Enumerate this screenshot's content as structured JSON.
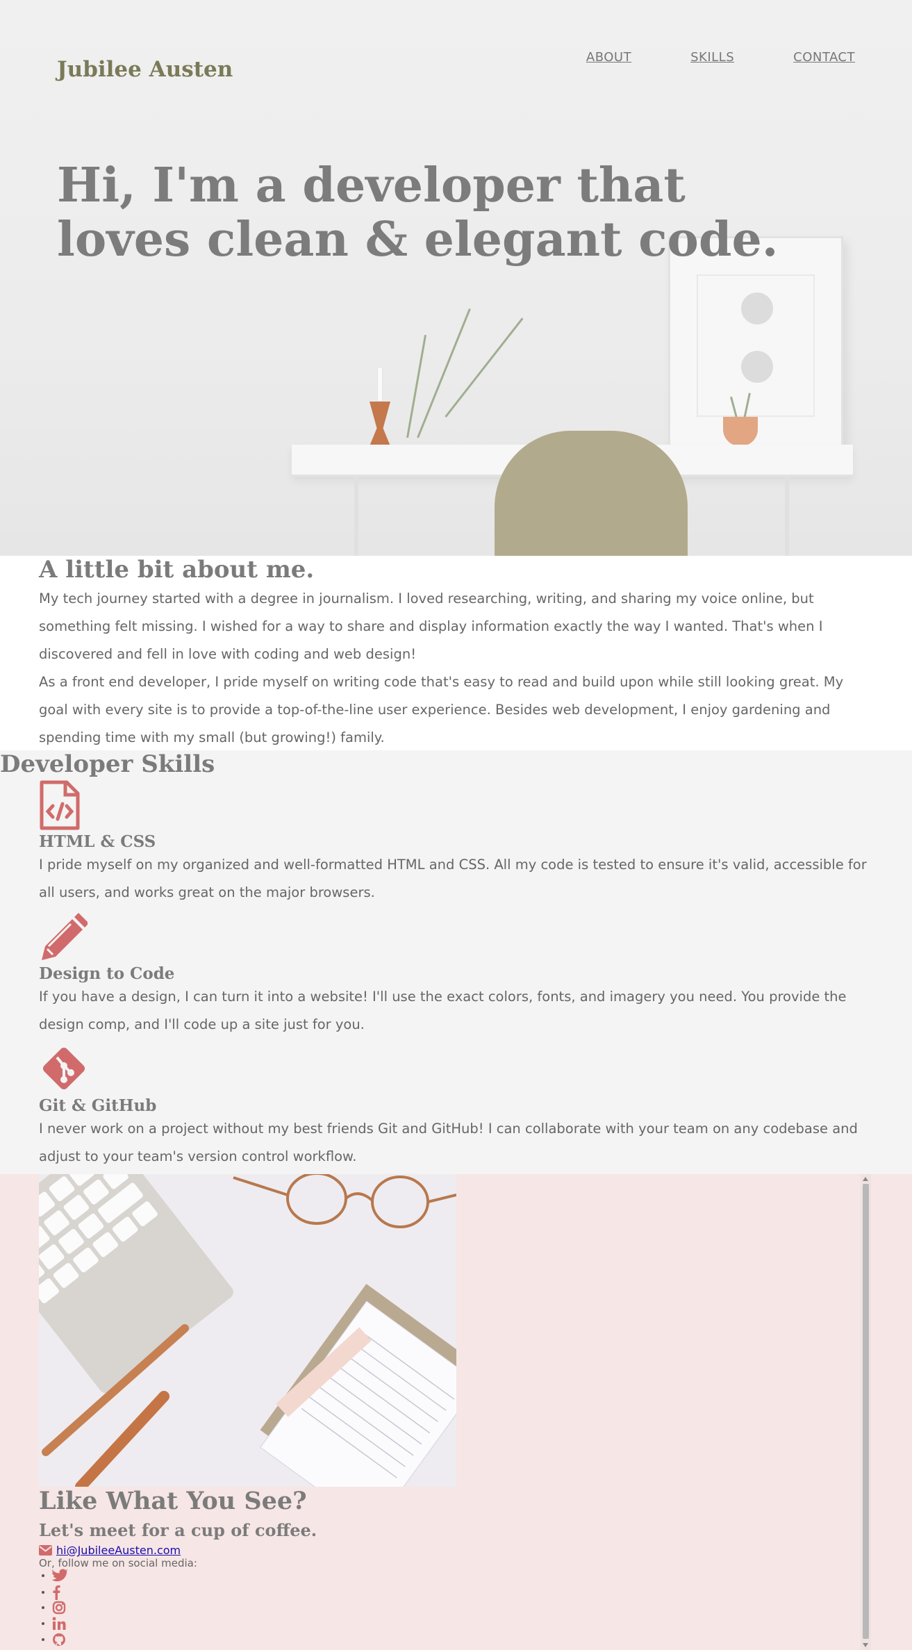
{
  "site": {
    "logo": "Jubilee Austen"
  },
  "nav": [
    {
      "label": "ABOUT"
    },
    {
      "label": "SKILLS"
    },
    {
      "label": "CONTACT"
    }
  ],
  "hero": {
    "title": "Hi, I'm a developer that loves clean & elegant code."
  },
  "about": {
    "heading": "A little bit about me.",
    "paragraphs": [
      "My tech journey started with a degree in journalism. I loved researching, writing, and sharing my voice online, but something felt missing. I wished for a way to share and display information exactly the way I wanted. That's when I discovered and fell in love with coding and web design!",
      "As a front end developer, I pride myself on writing code that's easy to read and build upon while still looking great. My goal with every site is to provide a top-of-the-line user experience. Besides web development, I enjoy gardening and spending time with my small (but growing!) family."
    ]
  },
  "skills": {
    "heading": "Developer Skills",
    "items": [
      {
        "icon": "file-code-icon",
        "title": "HTML & CSS",
        "text": "I pride myself on my organized and well-formatted HTML and CSS. All my code is tested to ensure it's valid, accessible for all users, and works great on the major browsers."
      },
      {
        "icon": "pencil-icon",
        "title": "Design to Code",
        "text": "If you have a design, I can turn it into a website! I'll use the exact colors, fonts, and imagery you need. You provide the design comp, and I'll code up a site just for you."
      },
      {
        "icon": "git-icon",
        "title": "Git & GitHub",
        "text": "I never work on a project without my best friends Git and GitHub! I can collaborate with your team on any codebase and adjust to your team's version control workflow."
      }
    ]
  },
  "contact": {
    "heading": "Like What You See?",
    "subheading": "Let's meet for a cup of coffee.",
    "email": "hi@JubileeAusten.com",
    "follow_text": "Or, follow me on social media:",
    "social": [
      "twitter-icon",
      "facebook-icon",
      "instagram-icon",
      "linkedin-icon",
      "github-icon"
    ]
  },
  "colors": {
    "accent": "#d16b6b",
    "logo": "#7a7a58",
    "heading": "#7b7b7b",
    "contact_bg": "#f7e6e6"
  }
}
